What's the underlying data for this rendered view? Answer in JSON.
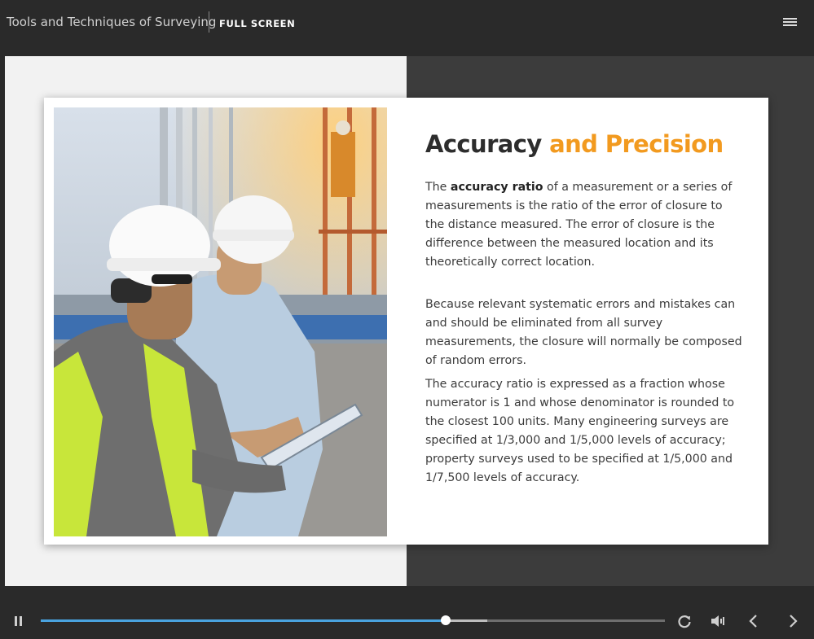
{
  "topbar": {
    "course_title": "Tools and Techniques of Surveying",
    "fullscreen_label": "FULL SCREEN",
    "menu_icon": "hamburger-menu-icon"
  },
  "slide": {
    "heading_part1": "Accuracy",
    "heading_part2": " and Precision",
    "paragraph1_prefix": "The ",
    "paragraph1_bold": "accuracy ratio",
    "paragraph1_rest": " of a measurement or a series of measurements is the ratio of the error of closure to the distance measured. The error of closure is the difference between the measured location and its theoretically correct location.",
    "paragraph2": "Because relevant systematic errors and mistakes can and should be eliminated from all survey measurements, the closure will normally be composed of random errors.",
    "paragraph3": "The accuracy ratio is expressed as a fraction whose numerator is 1 and whose denominator is rounded to the closest 100 units. Many engineering surveys are specified at 1/3,000 and 1/5,000 levels of accuracy; property surveys used to be specified at 1/5,000 and 1/7,500 levels of accuracy.",
    "image": "photo of two engineers in hard hats reviewing a tablet at a construction site"
  },
  "player": {
    "progress_fraction": 0.649,
    "buffered_fraction": 0.716,
    "icons": [
      "pause-icon",
      "replay-icon",
      "volume-icon",
      "chevron-left-icon",
      "chevron-right-icon"
    ]
  },
  "colors": {
    "accent": "#f29a1f",
    "progress": "#4aa3df",
    "background": "#2a2a2a"
  }
}
